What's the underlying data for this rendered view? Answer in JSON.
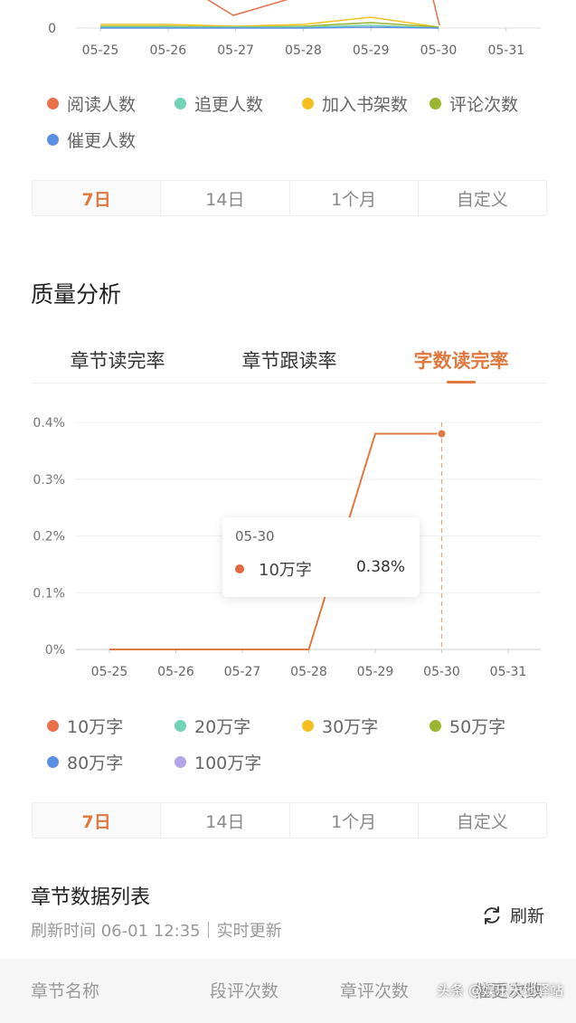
{
  "top_chart": {
    "x_ticks": [
      "05-25",
      "05-26",
      "05-27",
      "05-28",
      "05-29",
      "05-30",
      "05-31"
    ],
    "y_ticks": [
      "0"
    ],
    "legend": [
      {
        "label": "阅读人数",
        "color": "#e8704a"
      },
      {
        "label": "追更人数",
        "color": "#6fd3b4"
      },
      {
        "label": "加入书架数",
        "color": "#f4c022"
      },
      {
        "label": "评论次数",
        "color": "#9ab52f"
      },
      {
        "label": "催更人数",
        "color": "#5b8fe0"
      }
    ]
  },
  "top_range": {
    "options": [
      "7日",
      "14日",
      "1个月",
      "自定义"
    ],
    "selected": "7日"
  },
  "quality": {
    "title": "质量分析",
    "tabs": [
      "章节读完率",
      "章节跟读率",
      "字数读完率"
    ],
    "active_tab": "字数读完率"
  },
  "chart_data": {
    "type": "line",
    "categories": [
      "05-25",
      "05-26",
      "05-27",
      "05-28",
      "05-29",
      "05-30",
      "05-31"
    ],
    "y_ticks": [
      "0%",
      "0.1%",
      "0.2%",
      "0.3%",
      "0.4%"
    ],
    "ylim": [
      0,
      0.4
    ],
    "series": [
      {
        "name": "10万字",
        "color": "#e0793f",
        "values": [
          0,
          0,
          0,
          0,
          0.38,
          0.38,
          null
        ]
      }
    ],
    "legend": [
      {
        "label": "10万字",
        "color": "#e8704a"
      },
      {
        "label": "20万字",
        "color": "#6fd3b4"
      },
      {
        "label": "30万字",
        "color": "#f4c022"
      },
      {
        "label": "50万字",
        "color": "#9ab52f"
      },
      {
        "label": "80万字",
        "color": "#5b8fe0"
      },
      {
        "label": "100万字",
        "color": "#b3a6e8"
      }
    ],
    "tooltip": {
      "date": "05-30",
      "series": "10万字",
      "value": "0.38%"
    }
  },
  "bottom_range": {
    "options": [
      "7日",
      "14日",
      "1个月",
      "自定义"
    ],
    "selected": "7日"
  },
  "chapter_list": {
    "title": "章节数据列表",
    "refresh_time": "刷新时间 06-01 12:35｜实时更新",
    "refresh_label": "刷新",
    "columns": [
      "章节名称",
      "段评次数",
      "章评次数",
      "催更次数"
    ]
  },
  "watermark": "头条 @娱乐天地驿站"
}
